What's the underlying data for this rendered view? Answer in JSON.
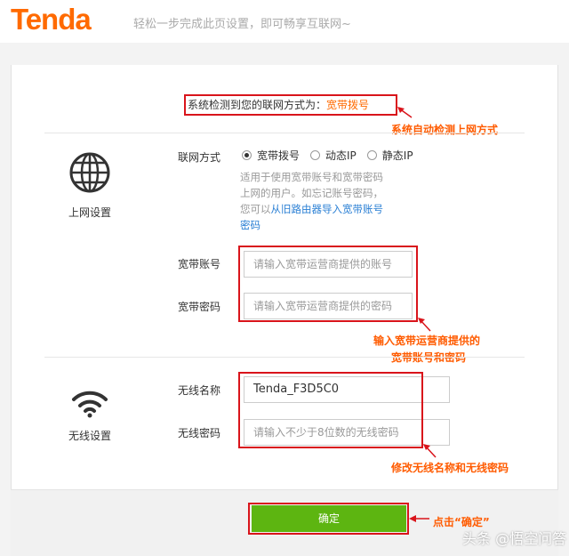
{
  "header": {
    "logo": "Tenda",
    "slogan": "轻松一步完成此页设置，即可畅享互联网~"
  },
  "detect": {
    "prefix": "系统检测到您的联网方式为：",
    "value": "宽带拨号"
  },
  "annotations": {
    "detect": "系统自动检测上网方式",
    "account_line1": "输入宽带运营商提供的",
    "account_line2": "宽带账号和密码",
    "wireless": "修改无线名称和无线密码",
    "confirm": "点击“确定”"
  },
  "internet": {
    "section_label": "上网设置",
    "icon": "globe-icon",
    "mode_label": "联网方式",
    "modes": [
      "宽带拨号",
      "动态IP",
      "静态IP"
    ],
    "selected_mode": "宽带拨号",
    "hint_line1": "适用于使用宽带账号和宽带密码",
    "hint_line2": "上网的用户。如忘记账号密码，",
    "hint_line3_prefix": "您可以",
    "hint_link": "从旧路由器导入宽带账号",
    "hint_line4": "密码",
    "account_label": "宽带账号",
    "account_placeholder": "请输入宽带运营商提供的账号",
    "password_label": "宽带密码",
    "password_placeholder": "请输入宽带运营商提供的密码"
  },
  "wireless": {
    "section_label": "无线设置",
    "icon": "wifi-icon",
    "ssid_label": "无线名称",
    "ssid_value": "Tenda_F3D5C0",
    "password_label": "无线密码",
    "password_placeholder": "请输入不少于8位数的无线密码"
  },
  "footer": {
    "confirm_label": "确定"
  },
  "watermark": "头条 @悟空问答",
  "colors": {
    "brand": "#ff6a00",
    "annotation": "#ff5b00",
    "highlight_border": "#d9141b",
    "button": "#5db511",
    "link": "#2a7fd4"
  }
}
